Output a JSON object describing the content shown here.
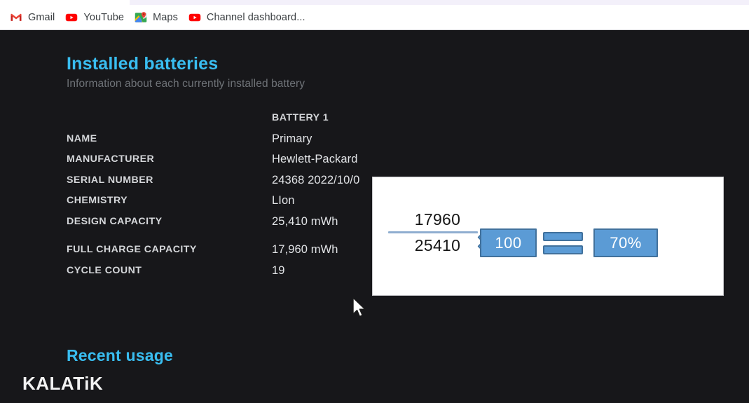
{
  "browser": {
    "bookmarks": [
      {
        "label": "Gmail",
        "icon": "gmail-icon"
      },
      {
        "label": "YouTube",
        "icon": "youtube-icon"
      },
      {
        "label": "Maps",
        "icon": "google-maps-icon"
      },
      {
        "label": "Channel dashboard...",
        "icon": "youtube-icon"
      }
    ]
  },
  "page": {
    "section": {
      "title": "Installed batteries",
      "subtitle": "Information about each currently installed battery"
    },
    "battery_table": {
      "column_header": "BATTERY 1",
      "rows": [
        {
          "label": "NAME",
          "value": "Primary"
        },
        {
          "label": "MANUFACTURER",
          "value": "Hewlett-Packard"
        },
        {
          "label": "SERIAL NUMBER",
          "value": "24368 2022/10/0"
        },
        {
          "label": "CHEMISTRY",
          "value": "LIon"
        },
        {
          "label": "DESIGN CAPACITY",
          "value": "25,410 mWh"
        },
        {
          "label": "FULL CHARGE CAPACITY",
          "value": "17,960 mWh"
        },
        {
          "label": "CYCLE COUNT",
          "value": "19"
        }
      ]
    },
    "recent_usage": {
      "title": "Recent usage"
    },
    "watermark": "KALATiK"
  },
  "math_overlay": {
    "numerator": "17960",
    "denominator": "25410",
    "multiply_symbol": "multiply-icon",
    "multiplier": "100",
    "equals_symbol": "equals-icon",
    "result": "70%"
  },
  "colors": {
    "page_background": "#17171a",
    "accent_heading": "#39bdf0",
    "subtitle": "#6f7378",
    "label_text": "#d4d6d9",
    "value_text": "#e2e4e7",
    "box_fill": "#5b9bd5",
    "box_border": "#41719c",
    "fraction_bar": "#8faed0",
    "overlay_background": "#ffffff",
    "bookmark_text": "#3c4043"
  }
}
